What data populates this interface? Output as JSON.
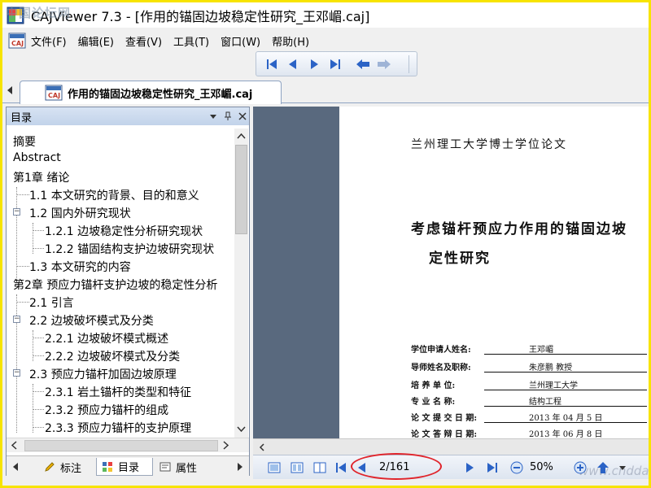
{
  "window": {
    "title": "CAJViewer 7.3 - [作用的锚固边坡稳定性研究_王邓嵋.caj]",
    "watermark_top_left": "中国论坛网",
    "watermark_bottom_right": "www.cnddao.com"
  },
  "menu": [
    "文件(F)",
    "编辑(E)",
    "查看(V)",
    "工具(T)",
    "窗口(W)",
    "帮助(H)"
  ],
  "doc_tab": {
    "label": "作用的锚固边坡稳定性研究_王邓嵋.caj"
  },
  "toc_panel": {
    "title": "目录",
    "items": [
      "摘要",
      "Abstract",
      "第1章 绪论",
      "1.1 本文研究的背景、目的和意义",
      "1.2 国内外研究现状",
      "1.2.1 边坡稳定性分析研究现状",
      "1.2.2 锚固结构支护边坡研究现状",
      "1.3 本文研究的内容",
      "第2章 预应力锚杆支护边坡的稳定性分析",
      "2.1 引言",
      "2.2 边坡破坏模式及分类",
      "2.2.1 边坡破坏模式概述",
      "2.2.2 边坡破坏模式及分类",
      "2.3 预应力锚杆加固边坡原理",
      "2.3.1 岩土锚杆的类型和特征",
      "2.3.2 预应力锚杆的组成",
      "2.3.3 预应力锚杆的支护原理"
    ],
    "tabs": [
      "标注",
      "目录",
      "属性"
    ]
  },
  "document": {
    "university_heading": "兰州理工大学博士学位论文",
    "thesis_title_line1": "考虑锚杆预应力作用的锚固边坡",
    "thesis_title_line2": "定性研究",
    "info": [
      {
        "label": "学位申请人姓名:",
        "value": "王邓嵋"
      },
      {
        "label": "导师姓名及职称:",
        "value": "朱彦鹏  教授"
      },
      {
        "label": "培  养  单  位:",
        "value": "兰州理工大学"
      },
      {
        "label": "专  业  名  称:",
        "value": "结构工程"
      },
      {
        "label": "论 文 提 交 日 期:",
        "value": "2013 年 04 月 5 日"
      },
      {
        "label": "论 文 答 辩 日 期:",
        "value": "2013 年 06 月 8 日"
      }
    ]
  },
  "status": {
    "page": "2/161",
    "zoom": "50%"
  },
  "colors": {
    "doc_background": "#59697e",
    "annotation_red": "#e0242b",
    "frame_yellow": "#f7e400"
  }
}
